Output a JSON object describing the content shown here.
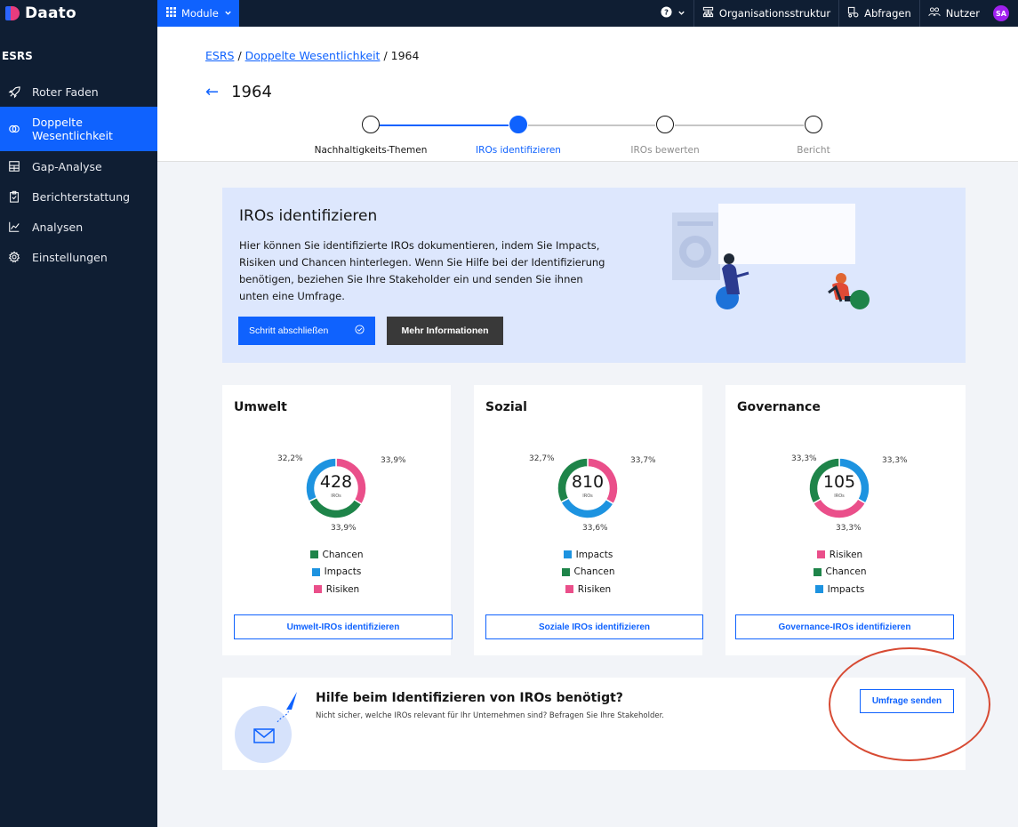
{
  "app": {
    "name": "Daato"
  },
  "topbar": {
    "module_label": "Module",
    "help_caret": "",
    "items": [
      {
        "label": "Organisationsstruktur"
      },
      {
        "label": "Abfragen"
      },
      {
        "label": "Nutzer"
      }
    ],
    "avatar_initials": "SA"
  },
  "sidebar": {
    "section": "ESRS",
    "items": [
      {
        "label": "Roter Faden",
        "icon": "rocket-icon"
      },
      {
        "label": "Doppelte Wesentlichkeit",
        "icon": "circles-icon",
        "active": true
      },
      {
        "label": "Gap-Analyse",
        "icon": "grid-icon"
      },
      {
        "label": "Berichterstattung",
        "icon": "clipboard-icon"
      },
      {
        "label": "Analysen",
        "icon": "chart-icon"
      },
      {
        "label": "Einstellungen",
        "icon": "gear-icon"
      }
    ]
  },
  "breadcrumb": {
    "root": "ESRS",
    "parent": "Doppelte Wesentlichkeit",
    "current": "1964"
  },
  "page": {
    "title": "1964"
  },
  "stepper": {
    "steps": [
      {
        "label": "Nachhaltigkeits-Themen",
        "state": "done"
      },
      {
        "label": "IROs identifizieren",
        "state": "current"
      },
      {
        "label": "IROs bewerten",
        "state": "todo"
      },
      {
        "label": "Bericht",
        "state": "todo"
      }
    ]
  },
  "hero": {
    "title": "IROs identifizieren",
    "text": "Hier können Sie identifizierte IROs dokumentieren, indem Sie Impacts, Risiken und Chancen hinterlegen. Wenn Sie Hilfe bei der Identifizierung benötigen, beziehen Sie Ihre Stakeholder ein und senden Sie ihnen unten eine Umfrage.",
    "primary_button": "Schritt abschließen",
    "secondary_button": "Mehr Informationen"
  },
  "colors": {
    "chancen": "#1e8449",
    "impacts": "#1d93e0",
    "risiken": "#ea4f8a",
    "accent": "#0f62fe"
  },
  "cards": [
    {
      "title": "Umwelt",
      "total": "428",
      "unit": "IROs",
      "legend": [
        "Chancen",
        "Impacts",
        "Risiken"
      ],
      "button": "Umwelt-IROs identifizieren"
    },
    {
      "title": "Sozial",
      "total": "810",
      "unit": "IROs",
      "legend": [
        "Impacts",
        "Chancen",
        "Risiken"
      ],
      "button": "Soziale IROs identifizieren"
    },
    {
      "title": "Governance",
      "total": "105",
      "unit": "IROs",
      "legend": [
        "Risiken",
        "Chancen",
        "Impacts"
      ],
      "button": "Governance-IROs identifizieren"
    }
  ],
  "chart_data": [
    {
      "type": "pie",
      "title": "Umwelt",
      "center_value": 428,
      "series": [
        {
          "name": "Risiken",
          "value": 33.9,
          "label": "33,9%"
        },
        {
          "name": "Chancen",
          "value": 33.9,
          "label": "33,9%"
        },
        {
          "name": "Impacts",
          "value": 32.2,
          "label": "32,2%"
        }
      ],
      "legend": "bottom"
    },
    {
      "type": "pie",
      "title": "Sozial",
      "center_value": 810,
      "series": [
        {
          "name": "Risiken",
          "value": 33.7,
          "label": "33,7%"
        },
        {
          "name": "Impacts",
          "value": 33.6,
          "label": "33,6%"
        },
        {
          "name": "Chancen",
          "value": 32.7,
          "label": "32,7%"
        }
      ],
      "legend": "bottom"
    },
    {
      "type": "pie",
      "title": "Governance",
      "center_value": 105,
      "series": [
        {
          "name": "Impacts",
          "value": 33.3,
          "label": "33,3%"
        },
        {
          "name": "Risiken",
          "value": 33.3,
          "label": "33,3%"
        },
        {
          "name": "Chancen",
          "value": 33.3,
          "label": "33,3%"
        }
      ],
      "legend": "bottom"
    }
  ],
  "survey": {
    "title": "Hilfe beim Identifizieren von IROs benötigt?",
    "subtitle": "Nicht sicher, welche IROs relevant für Ihr Unternehmen sind? Befragen Sie Ihre Stakeholder.",
    "button": "Umfrage senden"
  }
}
